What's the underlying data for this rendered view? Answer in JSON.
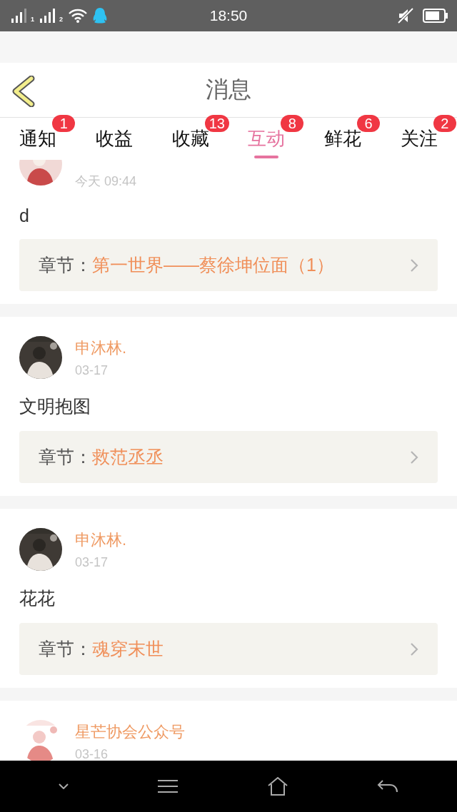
{
  "status_bar": {
    "sim_labels": [
      "1",
      "2"
    ],
    "time": "18:50"
  },
  "header": {
    "title": "消息"
  },
  "tabs": [
    {
      "label": "通知",
      "badge": "1",
      "selected": false
    },
    {
      "label": "收益",
      "selected": false
    },
    {
      "label": "收藏",
      "badge": "13",
      "selected": false
    },
    {
      "label": "互动",
      "badge": "8",
      "selected": true
    },
    {
      "label": "鲜花",
      "badge": "6",
      "selected": false
    },
    {
      "label": "关注",
      "badge": "2",
      "selected": false
    }
  ],
  "messages": [
    {
      "time": "今天 09:44",
      "text": "d",
      "chapter": {
        "label": "章节：",
        "title": "第一世界——蔡徐坤位面（1）"
      }
    },
    {
      "name": "申沐林.",
      "time": "03-17",
      "text": "文明抱图",
      "chapter": {
        "label": "章节：",
        "title": "救范丞丞"
      }
    },
    {
      "name": "申沐林.",
      "time": "03-17",
      "text": "花花",
      "chapter": {
        "label": "章节：",
        "title": "魂穿末世"
      }
    },
    {
      "name": "星芒协会公众号",
      "time": "03-16"
    }
  ]
}
